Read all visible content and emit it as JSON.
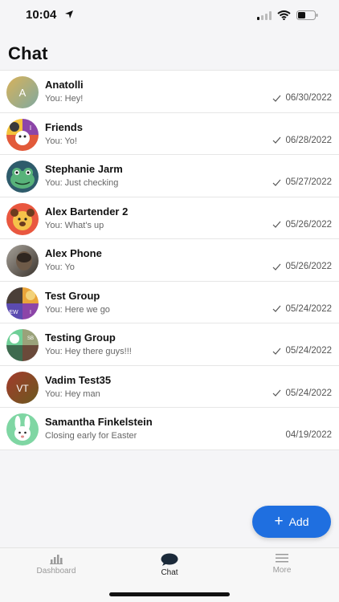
{
  "status_bar": {
    "time": "10:04"
  },
  "header": {
    "title": "Chat"
  },
  "chats": [
    {
      "name": "Anatolli",
      "preview": "You: Hey!",
      "date": "06/30/2022",
      "read": true,
      "avatar_initials": "A",
      "avatar_color": "#a9b07a"
    },
    {
      "name": "Friends",
      "preview": "You: Yo!",
      "date": "06/28/2022",
      "read": true,
      "avatar_initials": "",
      "avatar_color": "#e8663e"
    },
    {
      "name": "Stephanie Jarm",
      "preview": "You: Just checking",
      "date": "05/27/2022",
      "read": true,
      "avatar_initials": "",
      "avatar_color": "#2e5b6b"
    },
    {
      "name": "Alex Bartender 2",
      "preview": "You: What's up",
      "date": "05/26/2022",
      "read": true,
      "avatar_initials": "",
      "avatar_color": "#e9573f"
    },
    {
      "name": "Alex Phone",
      "preview": "You: Yo",
      "date": "05/26/2022",
      "read": true,
      "avatar_initials": "",
      "avatar_color": "#5a5046"
    },
    {
      "name": "Test Group",
      "preview": "You: Here we go",
      "date": "05/24/2022",
      "read": true,
      "avatar_initials": "",
      "avatar_color": "#7b3fa0"
    },
    {
      "name": "Testing Group",
      "preview": "You: Hey there guys!!!",
      "date": "05/24/2022",
      "read": true,
      "avatar_initials": "",
      "avatar_color": "#4f8f6f"
    },
    {
      "name": "Vadim Test35",
      "preview": "You: Hey man",
      "date": "05/24/2022",
      "read": true,
      "avatar_initials": "VT",
      "avatar_color": "#8a2f2c"
    },
    {
      "name": "Samantha Finkelstein",
      "preview": "Closing early for Easter",
      "date": "04/19/2022",
      "read": false,
      "avatar_initials": "",
      "avatar_color": "#7fd6a3"
    }
  ],
  "add_button": {
    "label": "Add",
    "color": "#1f6fe0"
  },
  "tabs": [
    {
      "label": "Dashboard",
      "icon": "bar-chart-icon",
      "active": false
    },
    {
      "label": "Chat",
      "icon": "chat-bubble-icon",
      "active": true
    },
    {
      "label": "More",
      "icon": "menu-icon",
      "active": false
    }
  ]
}
